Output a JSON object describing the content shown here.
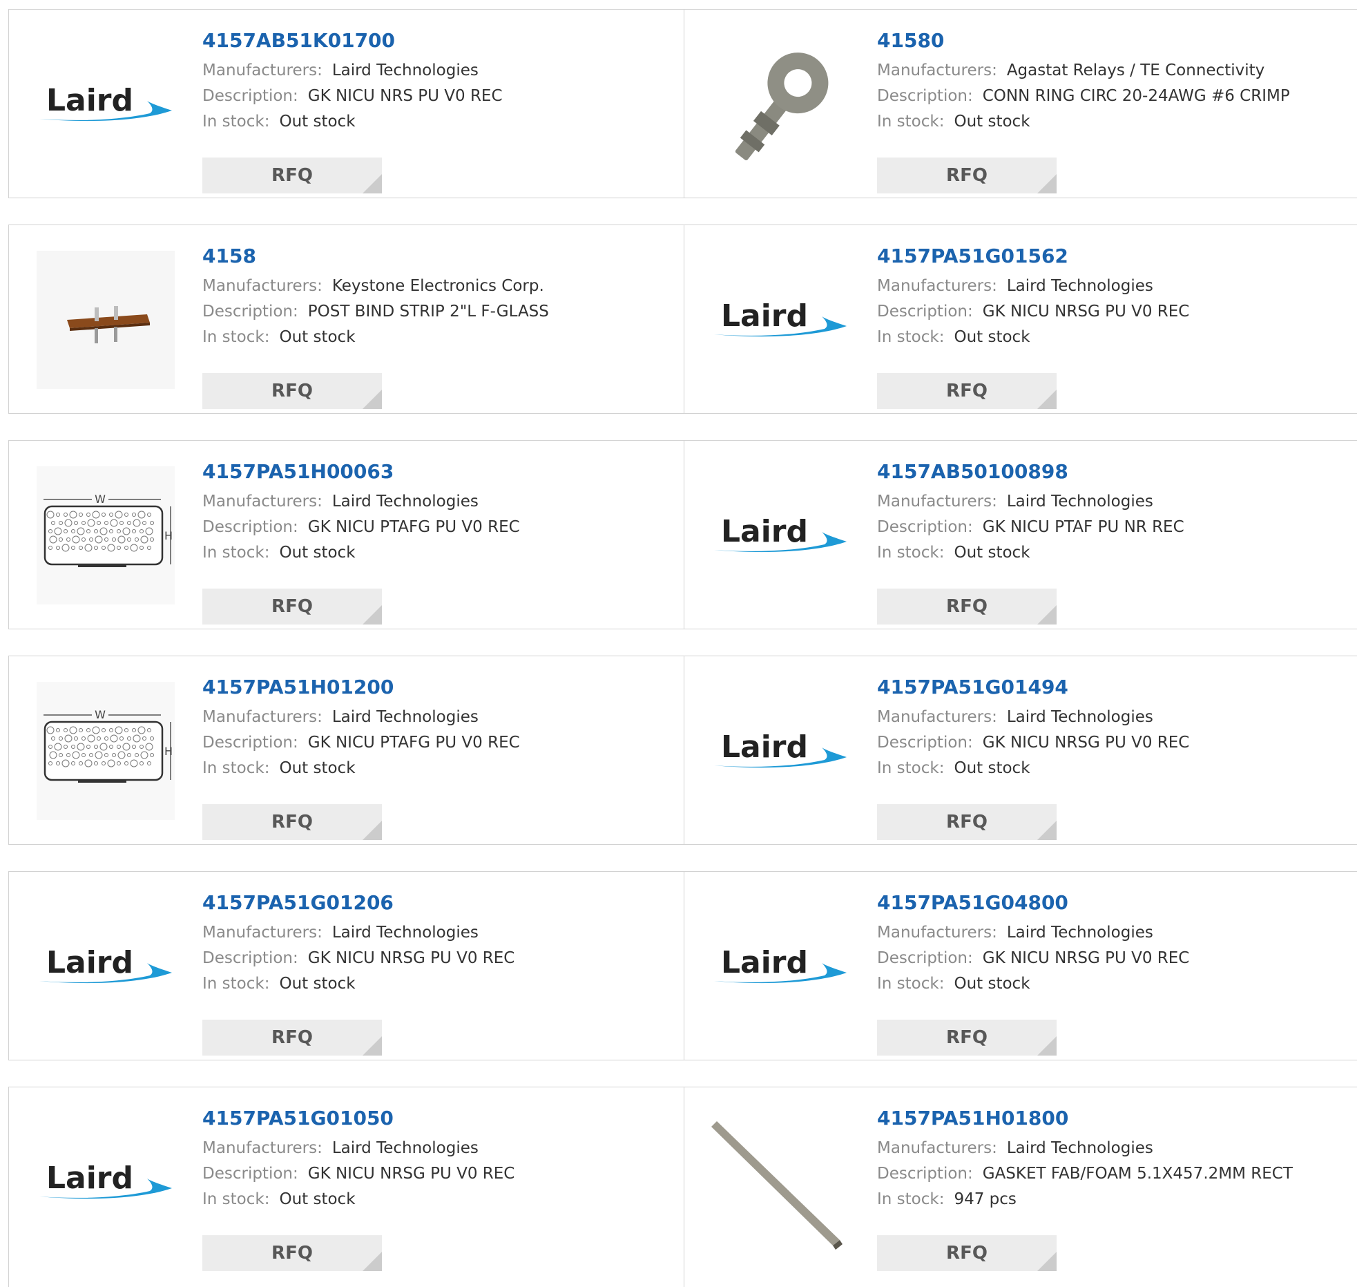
{
  "labels": {
    "manufacturers": "Manufacturers:",
    "description": "Description:",
    "in_stock": "In stock:",
    "rfq": "RFQ"
  },
  "logo": {
    "text": "Laird",
    "colors": {
      "text": "#222222",
      "swoosh": "#1e9ad6"
    }
  },
  "colors": {
    "part_number": "#1b63ae",
    "label": "#8a8a8a",
    "value": "#333333",
    "button_bg": "#ececec"
  },
  "rows": [
    [
      {
        "part": "4157AB51K01700",
        "manufacturer": "Laird Technologies",
        "description": "GK NICU NRS PU V0 REC",
        "stock": "Out stock",
        "image": "laird-logo"
      },
      {
        "part": "41580",
        "manufacturer": "Agastat Relays / TE Connectivity",
        "description": "CONN RING CIRC 20-24AWG #6 CRIMP",
        "stock": "Out stock",
        "image": "ring-terminal"
      }
    ],
    [
      {
        "part": "4158",
        "manufacturer": "Keystone Electronics Corp.",
        "description": "POST BIND STRIP 2\"L F-GLASS",
        "stock": "Out stock",
        "image": "binding-strip"
      },
      {
        "part": "4157PA51G01562",
        "manufacturer": "Laird Technologies",
        "description": "GK NICU NRSG PU V0 REC",
        "stock": "Out stock",
        "image": "laird-logo"
      }
    ],
    [
      {
        "part": "4157PA51H00063",
        "manufacturer": "Laird Technologies",
        "description": "GK NICU PTAFG PU V0 REC",
        "stock": "Out stock",
        "image": "gasket-diagram",
        "diagram": {
          "w": "W",
          "h": "H"
        }
      },
      {
        "part": "4157AB50100898",
        "manufacturer": "Laird Technologies",
        "description": "GK NICU PTAF PU NR REC",
        "stock": "Out stock",
        "image": "laird-logo"
      }
    ],
    [
      {
        "part": "4157PA51H01200",
        "manufacturer": "Laird Technologies",
        "description": "GK NICU PTAFG PU V0 REC",
        "stock": "Out stock",
        "image": "gasket-diagram",
        "diagram": {
          "w": "W",
          "h": "H"
        }
      },
      {
        "part": "4157PA51G01494",
        "manufacturer": "Laird Technologies",
        "description": "GK NICU NRSG PU V0 REC",
        "stock": "Out stock",
        "image": "laird-logo"
      }
    ],
    [
      {
        "part": "4157PA51G01206",
        "manufacturer": "Laird Technologies",
        "description": "GK NICU NRSG PU V0 REC",
        "stock": "Out stock",
        "image": "laird-logo"
      },
      {
        "part": "4157PA51G04800",
        "manufacturer": "Laird Technologies",
        "description": "GK NICU NRSG PU V0 REC",
        "stock": "Out stock",
        "image": "laird-logo"
      }
    ],
    [
      {
        "part": "4157PA51G01050",
        "manufacturer": "Laird Technologies",
        "description": "GK NICU NRSG PU V0 REC",
        "stock": "Out stock",
        "image": "laird-logo"
      },
      {
        "part": "4157PA51H01800",
        "manufacturer": "Laird Technologies",
        "description": "GASKET FAB/FOAM 5.1X457.2MM RECT",
        "stock": "947 pcs",
        "image": "gasket-strip"
      }
    ]
  ]
}
